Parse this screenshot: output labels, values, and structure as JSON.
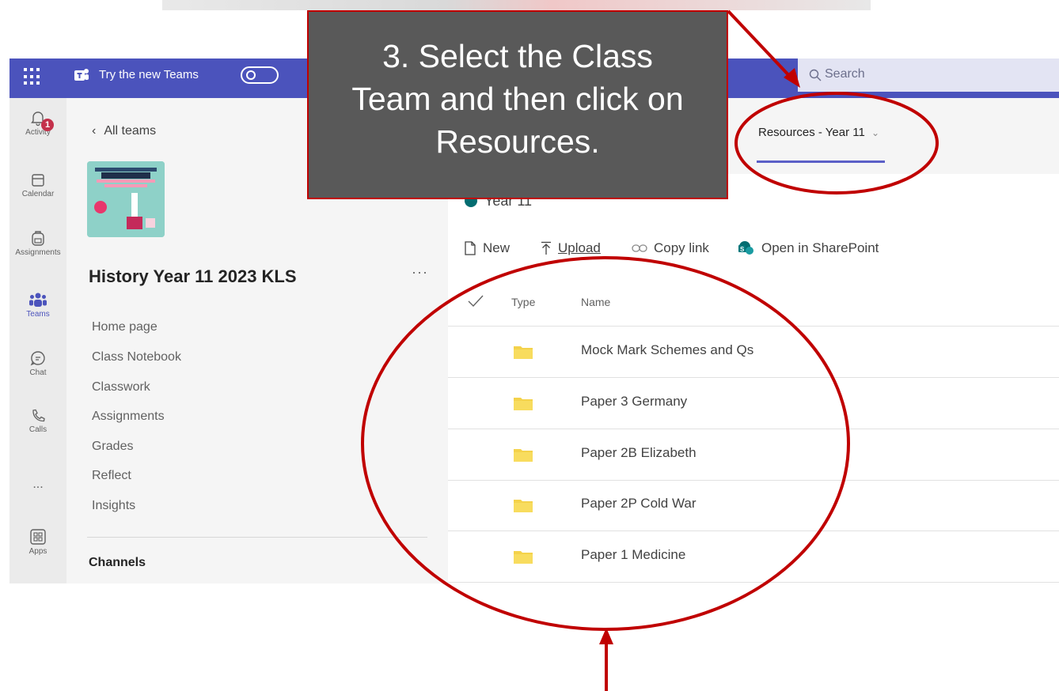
{
  "titlebar": {
    "try_new_teams": "Try the new Teams",
    "search_placeholder": "Search"
  },
  "rail": [
    {
      "label": "Activity",
      "badge": "1"
    },
    {
      "label": "Calendar"
    },
    {
      "label": "Assignments"
    },
    {
      "label": "Teams"
    },
    {
      "label": "Chat"
    },
    {
      "label": "Calls"
    },
    {
      "label": "..."
    },
    {
      "label": "Apps"
    }
  ],
  "leftpane": {
    "back_label": "All teams",
    "team_name": "History Year 11 2023 KLS",
    "more": "···",
    "nav": [
      "Home page",
      "Class Notebook",
      "Classwork",
      "Assignments",
      "Grades",
      "Reflect",
      "Insights"
    ],
    "channels_heading": "Channels"
  },
  "main": {
    "active_tab": "Resources - Year 11",
    "folder_title": "Year 11",
    "toolbar": {
      "new": "New",
      "upload": "Upload",
      "copy_link": "Copy link",
      "open_sharepoint": "Open in SharePoint"
    },
    "columns": {
      "type": "Type",
      "name": "Name"
    },
    "rows": [
      {
        "name": "Mock Mark Schemes and Qs"
      },
      {
        "name": "Paper 3 Germany"
      },
      {
        "name": "Paper 2B Elizabeth"
      },
      {
        "name": "Paper 2P Cold War"
      },
      {
        "name": "Paper 1 Medicine"
      }
    ]
  },
  "callout": {
    "line1": "3. Select the Class",
    "line2": "Team and then click on",
    "line3": "Resources."
  },
  "colors": {
    "brand": "#4b53bc",
    "annotation": "#c00000",
    "callout_bg": "#595959",
    "folder": "#f4d24b"
  }
}
